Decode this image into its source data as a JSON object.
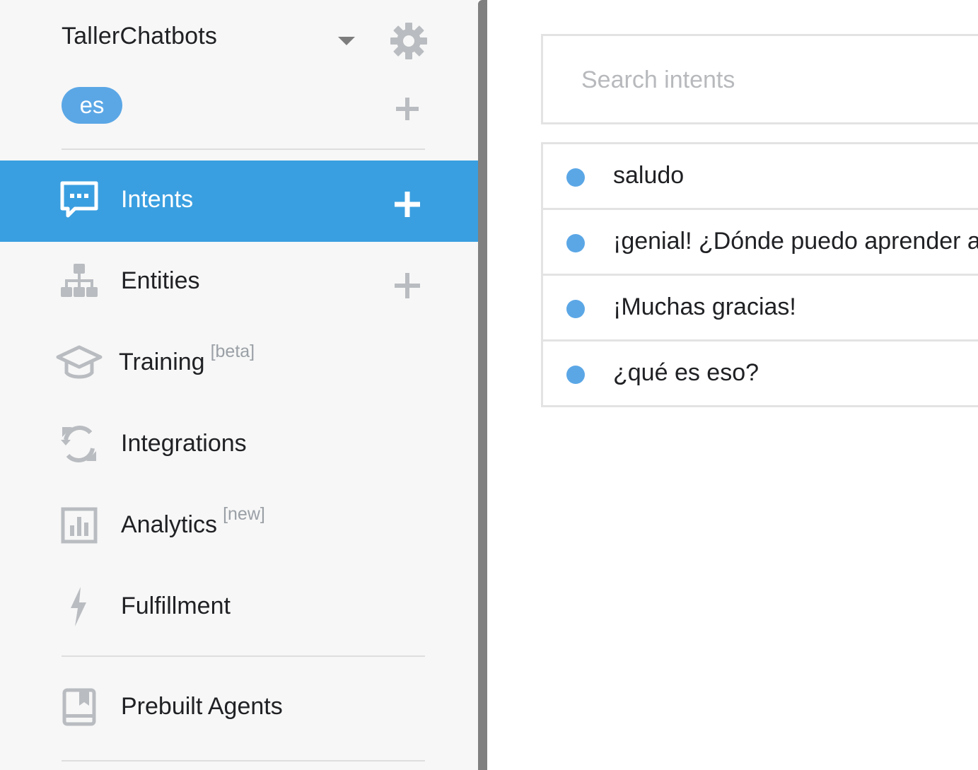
{
  "sidebar": {
    "agent_name": "TallerChatbots",
    "language": "es",
    "nav": [
      {
        "id": "intents",
        "label": "Intents",
        "sup": "",
        "icon": "chat-bubble-icon",
        "active": true,
        "add": true
      },
      {
        "id": "entities",
        "label": "Entities",
        "sup": "",
        "icon": "hierarchy-icon",
        "active": false,
        "add": true
      },
      {
        "id": "training",
        "label": "Training",
        "sup": "[beta]",
        "icon": "graduation-cap-icon",
        "active": false,
        "add": false
      },
      {
        "id": "integrations",
        "label": "Integrations",
        "sup": "",
        "icon": "sync-icon",
        "active": false,
        "add": false
      },
      {
        "id": "analytics",
        "label": "Analytics",
        "sup": "[new]",
        "icon": "bar-chart-icon",
        "active": false,
        "add": false
      },
      {
        "id": "fulfillment",
        "label": "Fulfillment",
        "sup": "",
        "icon": "lightning-icon",
        "active": false,
        "add": false
      }
    ],
    "prebuilt": {
      "label": "Prebuilt Agents",
      "icon": "book-icon"
    }
  },
  "main": {
    "search": {
      "placeholder": "Search intents",
      "value": ""
    },
    "intents": [
      {
        "name": "saludo"
      },
      {
        "name": "¡genial! ¿Dónde puedo aprender a"
      },
      {
        "name": "¡Muchas gracias!"
      },
      {
        "name": "¿qué es eso?"
      }
    ]
  },
  "colors": {
    "accent": "#3a9fe0",
    "dot": "#5ba7e6",
    "icon_grey": "#b9bcc0",
    "sidebar_bg": "#f7f7f7"
  }
}
